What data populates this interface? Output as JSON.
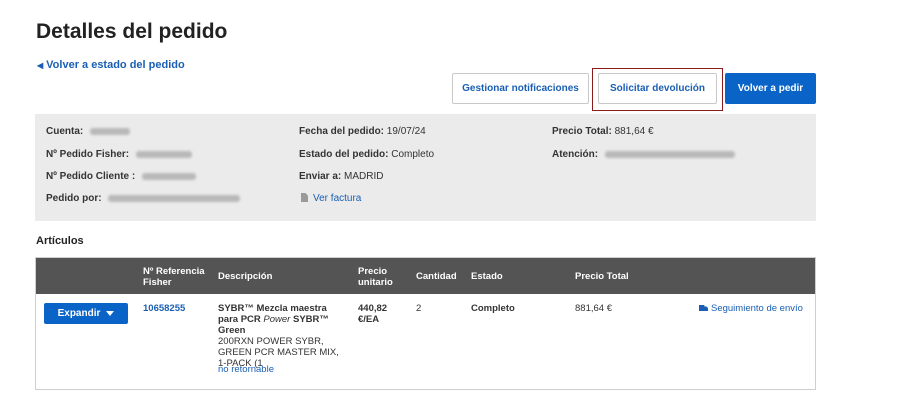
{
  "page": {
    "title": "Detalles del pedido",
    "back_link": "Volver a estado del pedido"
  },
  "actions": {
    "notifications": "Gestionar notificaciones",
    "return": "Solicitar devolución",
    "reorder": "Volver a pedir"
  },
  "order": {
    "col1": {
      "account_label": "Cuenta:",
      "fisher_order_label": "Nº Pedido Fisher:",
      "client_order_label": "Nº Pedido Cliente :",
      "ordered_by_label": "Pedido por:"
    },
    "col2": {
      "date_label": "Fecha del pedido:",
      "date_value": "19/07/24",
      "status_label": "Estado del pedido:",
      "status_value": "Completo",
      "ship_label": "Enviar a:",
      "ship_value": "MADRID",
      "invoice_link": "Ver factura"
    },
    "col3": {
      "total_label": "Precio Total:",
      "total_value": "881,64 €",
      "attention_label": "Atención:"
    }
  },
  "items_section": {
    "title": "Artículos",
    "headers": {
      "ref": "Nº Referencia Fisher",
      "desc": "Descripción",
      "unit_price": "Precio unitario",
      "qty": "Cantidad",
      "status": "Estado",
      "total": "Precio Total"
    },
    "rows": [
      {
        "expand": "Expandir",
        "ref": "10658255",
        "desc_pre": "SYBR™ Mezcla maestra para PCR ",
        "desc_italic": "Power",
        "desc_post": " SYBR™ Green",
        "desc_detail": "200RXN POWER SYBR, GREEN PCR MASTER MIX, 1-PACK (1",
        "non_returnable": "no retornable",
        "unit_price": "440,82 €/EA",
        "qty": "2",
        "status": "Completo",
        "total": "881,64 €",
        "tracking": "Seguimiento de envío"
      }
    ]
  },
  "icons": {
    "back": "caret-left-icon",
    "invoice": "document-icon",
    "expand": "caret-down-icon",
    "tracking": "truck-icon"
  },
  "colors": {
    "primary": "#0a64c8",
    "link": "#1a5fb4",
    "header_bg": "#545454",
    "info_bg": "#ebebeb",
    "highlight_border": "#8b1a1a"
  }
}
